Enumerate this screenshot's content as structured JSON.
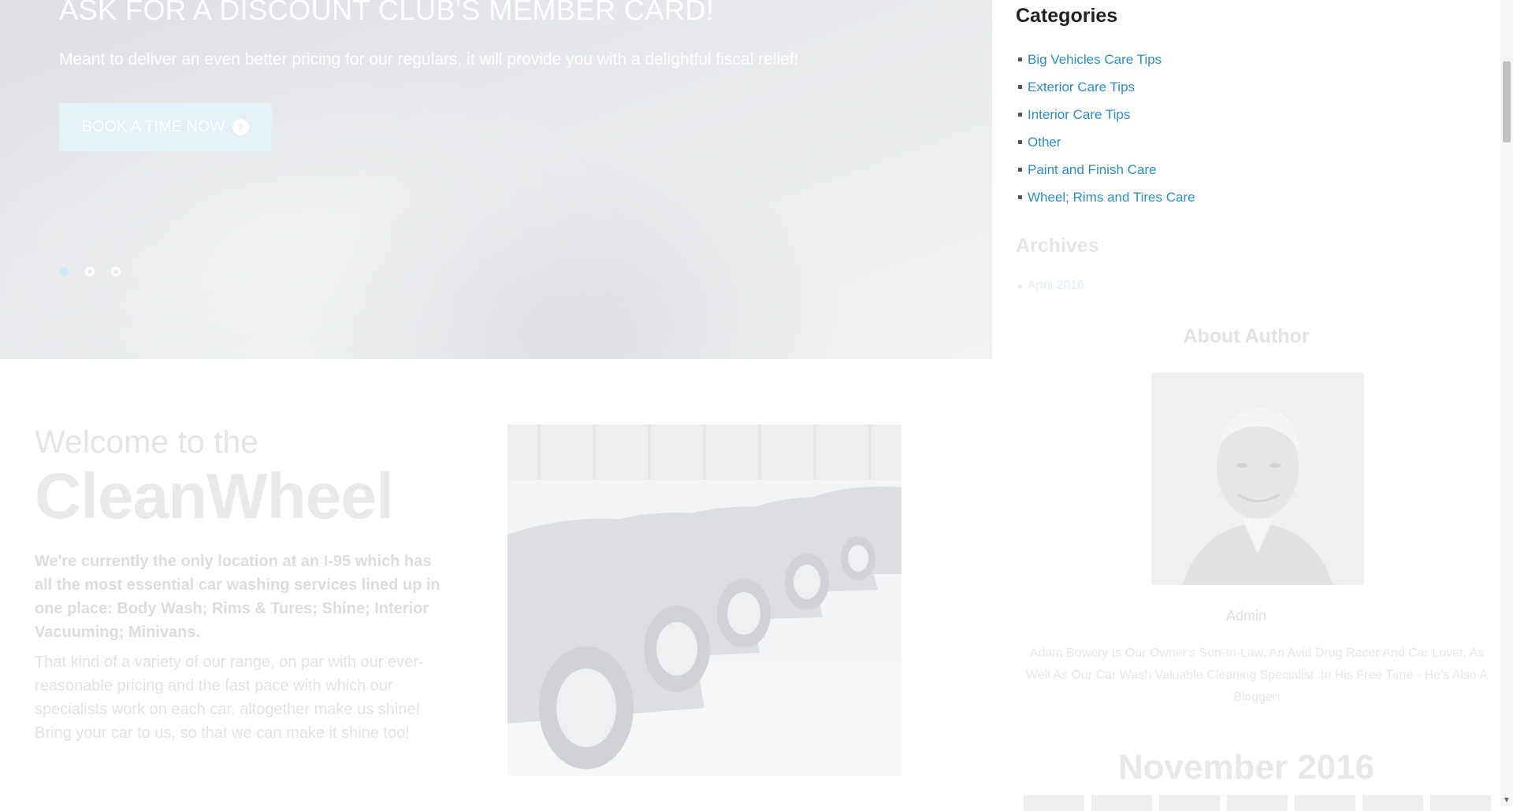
{
  "hero": {
    "title": "ASK FOR A DISCOUNT CLUB'S MEMBER CARD!",
    "text": "Meant to deliver an even better pricing for our regulars, it will provide you with a delightful fiscal relief!",
    "button_label": "BOOK A TIME NOW",
    "button_icon": "arrow-right-circle-icon",
    "slides_count": 3,
    "active_slide": 1
  },
  "welcome": {
    "pre_title": "Welcome to the",
    "brand": "CleanWheel",
    "lead": "We're currently the only location at an I-95 which has all the most essential car washing services lined up in one place: Body Wash; Rims & Tures; Shine; Interior Vacuuming; Minivans.",
    "body": "That kind of a variety of our range, on par with our ever-reasonable pricing and the fast pace with which our specialists work on each car, altogether make us shine! Bring your car to us, so that we can make it shine too!"
  },
  "sidebar": {
    "categories_title": "Categories",
    "categories": [
      "Big Vehicles Care Tips",
      "Exterior Care Tips",
      "Interior Care Tips",
      "Other",
      "Paint and Finish Care",
      "Wheel; Rims and Tires Care"
    ],
    "archives_title": "Archives",
    "archives": [
      "April 2016"
    ],
    "about_title": "About Author",
    "author_name": "Admin",
    "author_bio": "Adam Bowery Is Our Owner's Son-In-Law, An Avid Drug Racer And Car Lover, As Well As Our Car Wash Valuable Cleaning Specialist. In His Free Time - He's Also A Blogger!",
    "calendar_title": "November 2016"
  },
  "colors": {
    "link": "#2a8ec7",
    "heading": "#222222",
    "button_bg": "#e5f1f7"
  }
}
